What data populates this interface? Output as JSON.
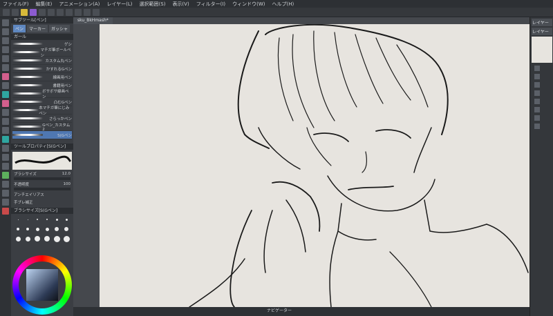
{
  "menu": [
    "ファイル(F)",
    "編集(E)",
    "アニメーション(A)",
    "レイヤー(L)",
    "選択範囲(S)",
    "表示(V)",
    "フィルター(I)",
    "ウィンドウ(W)",
    "ヘルプ(H)"
  ],
  "left_panel": {
    "title": "サブツール[ペン]",
    "tabs": [
      "ペン",
      "マーカー",
      "ガッシャ"
    ],
    "group_label": "ガ一ル",
    "brushes": [
      "ゲシ",
      "マチガ筆ボールペン",
      "カスタム丸ペン",
      "かすれるGペン",
      "線画用ペン",
      "書籍用ペン",
      "ボサボサ線画ペン",
      "凸むGペン",
      "本マチガ筆にじみペン",
      "さらっかペン",
      "Gペン_カスタム2",
      "S(Gペン"
    ],
    "selected_brush_index": 11
  },
  "tool_property": {
    "title": "ツールプロパティ[S(Gペン]",
    "brush_size_label": "ブラシサイズ",
    "brush_size_value": "12.0",
    "opacity_label": "不透明度",
    "opacity_value": "100",
    "antialias_label": "アンチエイリアス",
    "stabilize_label": "手ブレ補正"
  },
  "brush_size_panel": {
    "title": "ブラシサイズ[S(Gペン]",
    "sizes": [
      "1",
      "1.5",
      "2",
      "3",
      "4",
      "5",
      "6",
      "7",
      "8",
      "10",
      "12",
      "15",
      "17",
      "20",
      "25",
      "30",
      "40",
      "50",
      "60",
      "70",
      "80",
      "100",
      "120",
      "150"
    ]
  },
  "document_tab": "sku_BkHmash*",
  "navigator_label": "ナビゲーター",
  "right_panel": {
    "tab1": "レイヤー",
    "tab2": "レイヤー"
  },
  "colors": {
    "accent": "#5e87c0",
    "paper": "#e7e4df",
    "panel": "#3b3e43"
  }
}
